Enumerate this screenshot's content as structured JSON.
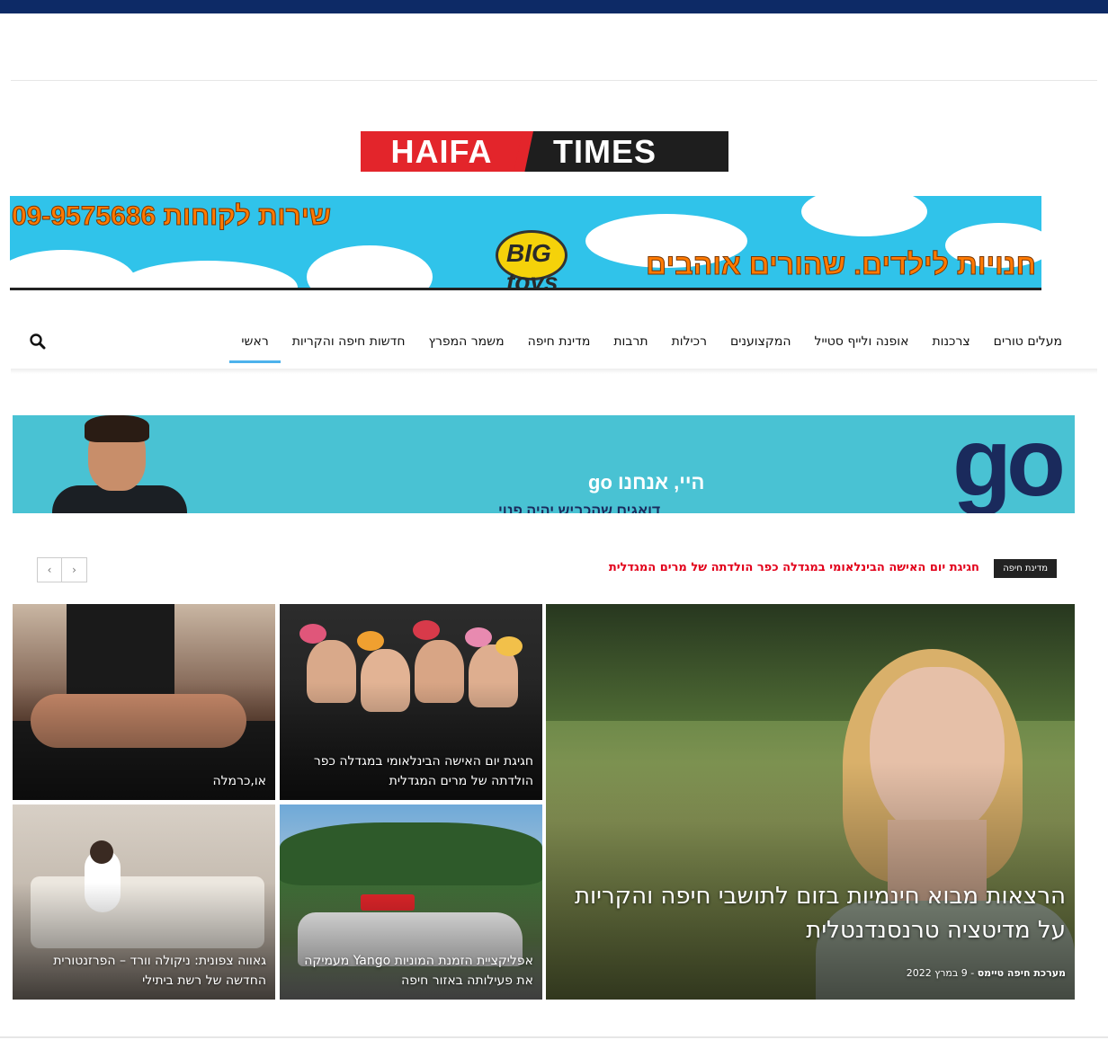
{
  "logo": {
    "left_text": "HAIFA",
    "right_text": "TIMES"
  },
  "top_ad": {
    "phone": "שירות לקוחות 09-9575686",
    "slogan": "חנויות לילדים. שהורים אוהבים",
    "brand": "BIG toys"
  },
  "nav": {
    "items": [
      {
        "label": "ראשי",
        "active": true
      },
      {
        "label": "חדשות חיפה והקריות"
      },
      {
        "label": "משמר המפרץ"
      },
      {
        "label": "מדינת חיפה"
      },
      {
        "label": "תרבות"
      },
      {
        "label": "רכילות"
      },
      {
        "label": "המקצוענים"
      },
      {
        "label": "אופנה ולייף סטייל"
      },
      {
        "label": "צרכנות"
      },
      {
        "label": "מעלים טורים"
      }
    ],
    "search_icon": "search-icon"
  },
  "go_ad": {
    "logo": "go",
    "headline": "היי, אנחנו go",
    "subline": "דואגים שהכביש יהיה פנוי"
  },
  "ticker": {
    "badge": "מדינת חיפה",
    "headline": "חגיגת יום האישה הבינלאומי במגדלה כפר הולדתה של מרים המגדלית",
    "prev_icon": "chevron-left-icon",
    "next_icon": "chevron-right-icon"
  },
  "featured": {
    "title": "הרצאות מבוא חינמיות בזום לתושבי חיפה והקריות על מדיטציה טרנסנדנטלית",
    "author": "מערכת חיפה טיימס",
    "separator": " - ",
    "date": "9 במרץ 2022"
  },
  "tiles": [
    {
      "title": "חגיגת יום האישה הבינלאומי במגדלה כפר הולדתה של מרים המגדלית"
    },
    {
      "title": "או,כרמלה"
    },
    {
      "title": "אפליקציית הזמנת המוניות Yango מעמיקה את פעילותה באזור חיפה"
    },
    {
      "title": "גאווה צפונית: ניקולה וורד – הפרזנטורית החדשה של רשת ביתילי"
    }
  ]
}
